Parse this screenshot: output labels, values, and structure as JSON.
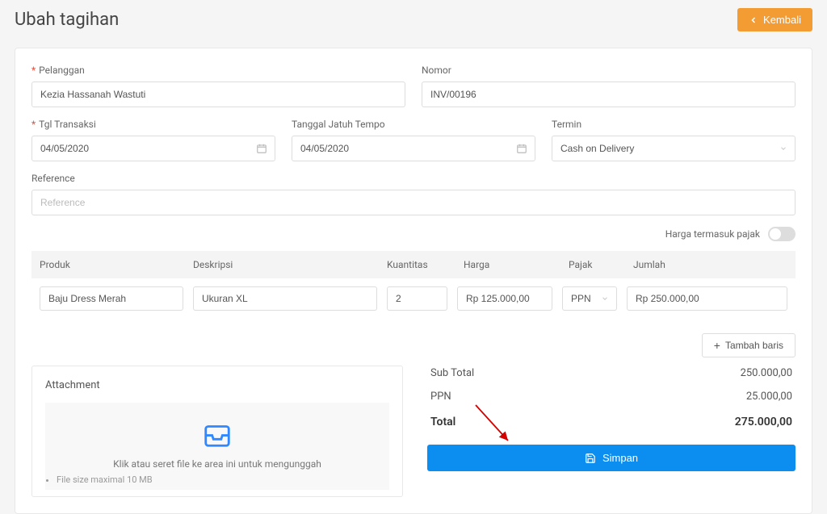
{
  "header": {
    "title": "Ubah tagihan",
    "back_label": "Kembali"
  },
  "form": {
    "customer_label": "Pelanggan",
    "customer_value": "Kezia Hassanah Wastuti",
    "number_label": "Nomor",
    "number_value": "INV/00196",
    "trx_date_label": "Tgl Transaksi",
    "trx_date_value": "04/05/2020",
    "due_date_label": "Tanggal Jatuh Tempo",
    "due_date_value": "04/05/2020",
    "term_label": "Termin",
    "term_value": "Cash on Delivery",
    "reference_label": "Reference",
    "reference_placeholder": "Reference",
    "tax_inclusive_label": "Harga termasuk pajak"
  },
  "table": {
    "cols": {
      "product": "Produk",
      "desc": "Deskripsi",
      "qty": "Kuantitas",
      "price": "Harga",
      "tax": "Pajak",
      "amount": "Jumlah"
    },
    "rows": [
      {
        "product": "Baju Dress Merah",
        "desc": "Ukuran XL",
        "qty": "2",
        "price": "Rp 125.000,00",
        "tax": "PPN",
        "amount": "Rp 250.000,00"
      }
    ],
    "add_row_label": "Tambah baris"
  },
  "attachment": {
    "title": "Attachment",
    "drop_text": "Klik atau seret file ke area ini untuk mengunggah",
    "hint": "File size maximal 10 MB"
  },
  "totals": {
    "subtotal_label": "Sub Total",
    "subtotal_value": "250.000,00",
    "ppn_label": "PPN",
    "ppn_value": "25.000,00",
    "total_label": "Total",
    "total_value": "275.000,00",
    "save_label": "Simpan"
  }
}
